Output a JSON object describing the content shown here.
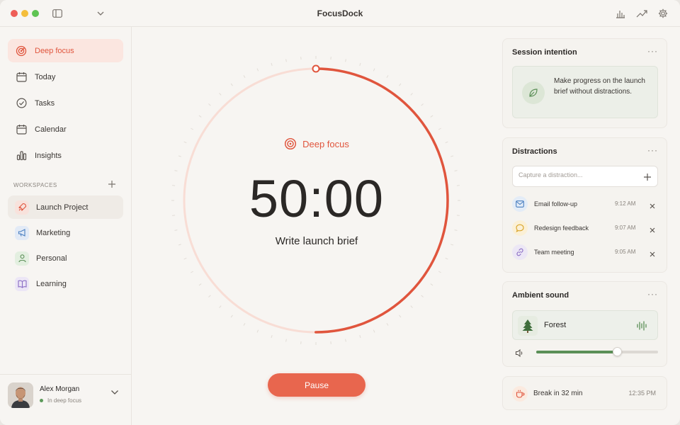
{
  "app": {
    "title": "FocusDock"
  },
  "colors": {
    "accent": "#e0553d",
    "green": "#5b8f57",
    "background": "#f7f5f2"
  },
  "titlebar": {
    "icons": [
      "sidebar-toggle-icon",
      "chevron-down-icon",
      "bar-chart-icon",
      "trend-icon",
      "gear-icon"
    ]
  },
  "sidebar": {
    "nav": [
      {
        "label": "Deep focus",
        "icon": "target-icon",
        "active": true
      },
      {
        "label": "Today",
        "icon": "calendar-icon"
      },
      {
        "label": "Tasks",
        "icon": "check-circle-icon"
      },
      {
        "label": "Calendar",
        "icon": "calendar-icon"
      },
      {
        "label": "Insights",
        "icon": "insights-icon"
      }
    ],
    "workspaces_heading": "WORKSPACES",
    "workspaces": [
      {
        "label": "Launch Project",
        "icon": "rocket-icon",
        "selected": true
      },
      {
        "label": "Marketing",
        "icon": "megaphone-icon"
      },
      {
        "label": "Personal",
        "icon": "person-icon"
      },
      {
        "label": "Learning",
        "icon": "book-icon"
      }
    ],
    "user": {
      "name": "Alex Morgan",
      "status": "In deep focus"
    }
  },
  "focus": {
    "mode": "Deep focus",
    "timer": "50:00",
    "task": "Write launch brief",
    "progress": 0.5,
    "pause_label": "Pause"
  },
  "intention": {
    "title": "Session intention",
    "text": "Make progress on the launch brief without distractions."
  },
  "distractions": {
    "title": "Distractions",
    "placeholder": "Capture a distraction...",
    "items": [
      {
        "label": "Email follow-up",
        "time": "9:12 AM",
        "icon": "mail-icon",
        "color": "#e3ecf7",
        "stroke": "#4a7fc0"
      },
      {
        "label": "Redesign feedback",
        "time": "9:07 AM",
        "icon": "chat-icon",
        "color": "#fbf0d6",
        "stroke": "#d9a326"
      },
      {
        "label": "Team meeting",
        "time": "9:05 AM",
        "icon": "link-icon",
        "color": "#ece7f5",
        "stroke": "#8a6cc4"
      }
    ]
  },
  "ambient": {
    "title": "Ambient sound",
    "sound": "Forest",
    "volume": 0.66
  },
  "break": {
    "label": "Break in 32 min",
    "time": "12:35 PM"
  }
}
